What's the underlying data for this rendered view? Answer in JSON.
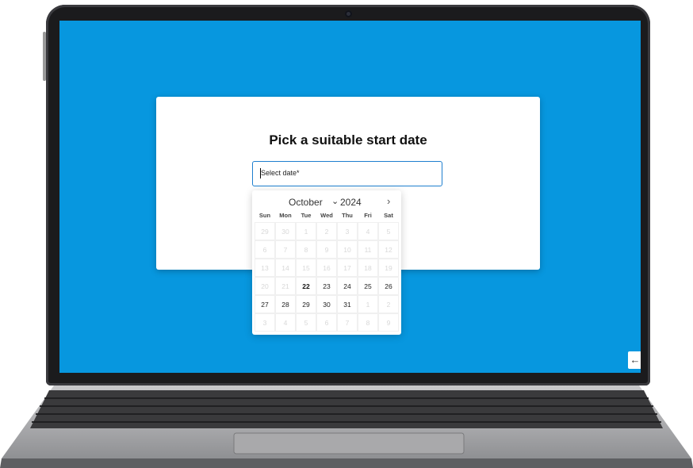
{
  "card": {
    "title": "Pick a suitable start date",
    "input_placeholder": "Select date*"
  },
  "calendar": {
    "month": "October",
    "year": "2024",
    "weekdays": [
      "Sun",
      "Mon",
      "Tue",
      "Wed",
      "Thu",
      "Fri",
      "Sat"
    ],
    "weeks": [
      [
        "29",
        "30",
        "1",
        "2",
        "3",
        "4",
        "5"
      ],
      [
        "6",
        "7",
        "8",
        "9",
        "10",
        "11",
        "12"
      ],
      [
        "13",
        "14",
        "15",
        "16",
        "17",
        "18",
        "19"
      ],
      [
        "20",
        "21",
        "22",
        "23",
        "24",
        "25",
        "26"
      ],
      [
        "27",
        "28",
        "29",
        "30",
        "31",
        "1",
        "2"
      ],
      [
        "3",
        "4",
        "5",
        "6",
        "7",
        "8",
        "9"
      ]
    ],
    "today": "22"
  },
  "icons": {
    "month_dropdown": "chevron-down-icon",
    "next_month": "chevron-right-icon",
    "back": "arrow-left-icon"
  },
  "colors": {
    "screen_background": "#0797df",
    "input_border": "#1e7fcf"
  }
}
